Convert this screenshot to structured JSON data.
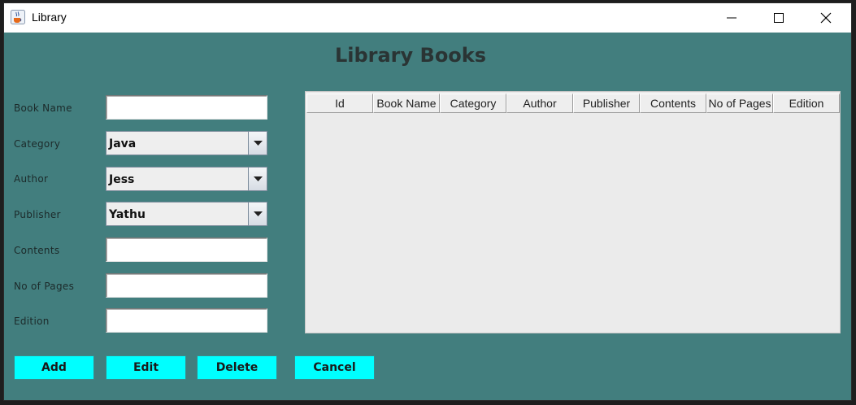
{
  "window": {
    "title": "Library",
    "app_icon": "java-cup-icon",
    "controls": [
      "minimize-icon",
      "maximize-icon",
      "close-icon"
    ]
  },
  "form": {
    "heading": "Library Books",
    "book_name": {
      "label": "Book Name",
      "value": ""
    },
    "category": {
      "label": "Category",
      "value": "Java"
    },
    "author": {
      "label": "Author",
      "value": "Jess"
    },
    "publisher": {
      "label": "Publisher",
      "value": "Yathu"
    },
    "contents": {
      "label": "Contents",
      "value": ""
    },
    "no_of_pages": {
      "label": "No of Pages",
      "value": ""
    },
    "edition": {
      "label": "Edition",
      "value": ""
    }
  },
  "table": {
    "columns": [
      "Id",
      "Book Name",
      "Category",
      "Author",
      "Publisher",
      "Contents",
      "No of Pages",
      "Edition"
    ],
    "rows": []
  },
  "buttons": {
    "add": "Add",
    "edit": "Edit",
    "delete": "Delete",
    "cancel": "Cancel"
  },
  "colors": {
    "background": "#427e7e",
    "button": "#00ffff",
    "heading": "#2a3434"
  }
}
